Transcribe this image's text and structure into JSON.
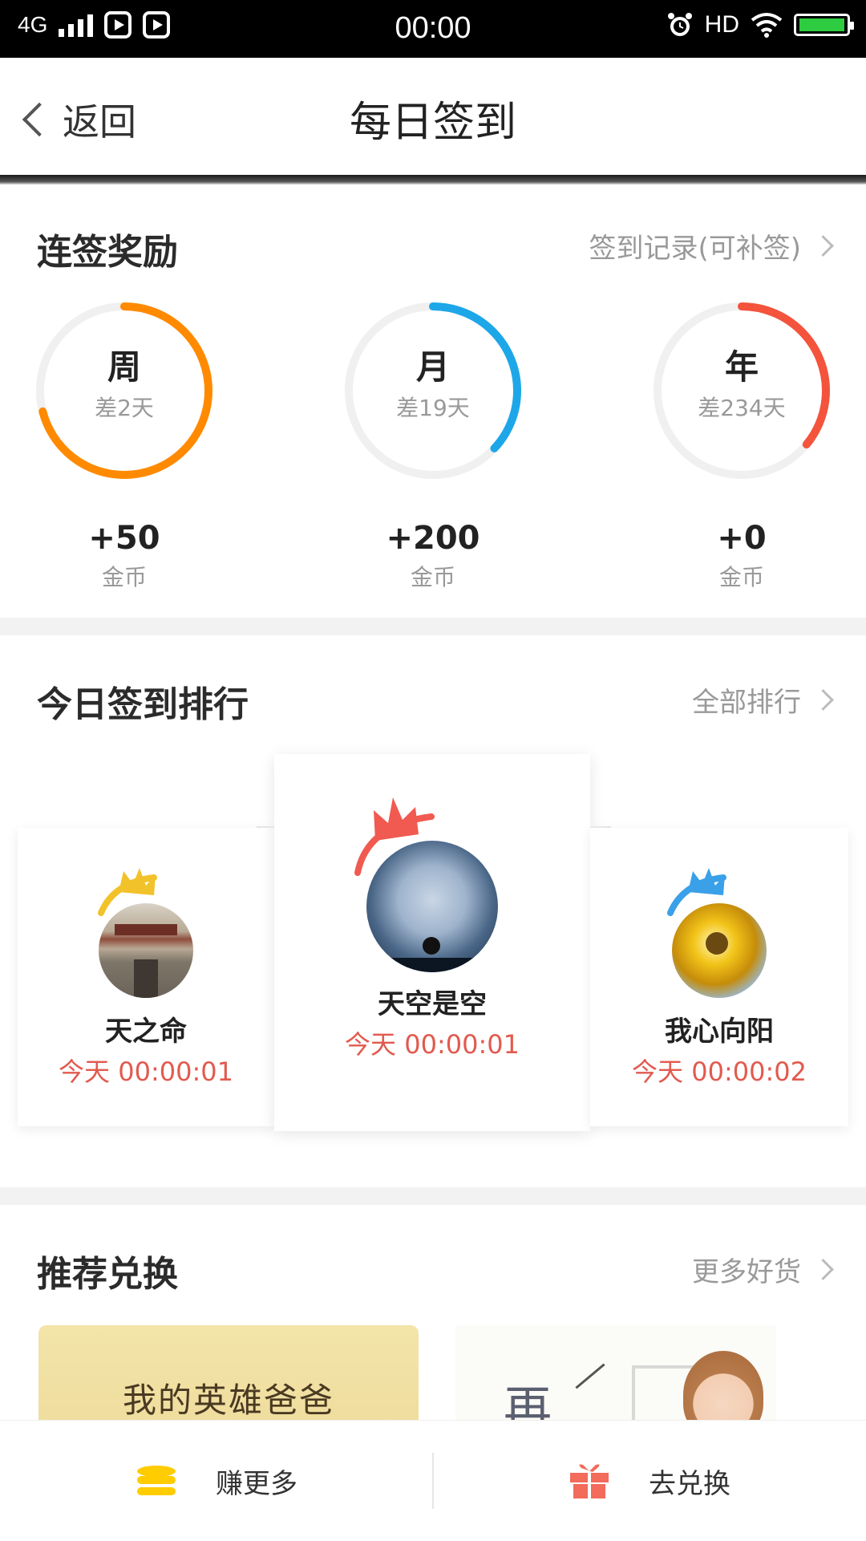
{
  "status_bar": {
    "network": "4G",
    "time": "00:00",
    "hd": "HD"
  },
  "header": {
    "back_label": "返回",
    "title": "每日签到"
  },
  "streak": {
    "title": "连签奖励",
    "link": "签到记录(可补签)",
    "rings": [
      {
        "label": "周",
        "sub": "差2天",
        "amount": "+50",
        "unit": "金币",
        "progress": 0.71,
        "color": "#ff8a00"
      },
      {
        "label": "月",
        "sub": "差19天",
        "amount": "+200",
        "unit": "金币",
        "progress": 0.37,
        "color": "#1ea7e8"
      },
      {
        "label": "年",
        "sub": "差234天",
        "amount": "+0",
        "unit": "金币",
        "progress": 0.36,
        "color": "#f4533c"
      }
    ]
  },
  "ranking": {
    "title": "今日签到排行",
    "link": "全部排行",
    "entries": [
      {
        "rank": 2,
        "name": "天之命",
        "time": "今天 00:00:01",
        "crown_color": "#f2c22a"
      },
      {
        "rank": 1,
        "name": "天空是空",
        "time": "今天 00:00:01",
        "crown_color": "#f05a50"
      },
      {
        "rank": 3,
        "name": "我心向阳",
        "time": "今天 00:00:02",
        "crown_color": "#3aa0e8"
      }
    ]
  },
  "recommend": {
    "title": "推荐兑换",
    "link": "更多好货",
    "items": [
      {
        "text": "我的英雄爸爸"
      },
      {
        "text": "再"
      }
    ]
  },
  "bottom_bar": {
    "earn_label": "赚更多",
    "exchange_label": "去兑换"
  }
}
